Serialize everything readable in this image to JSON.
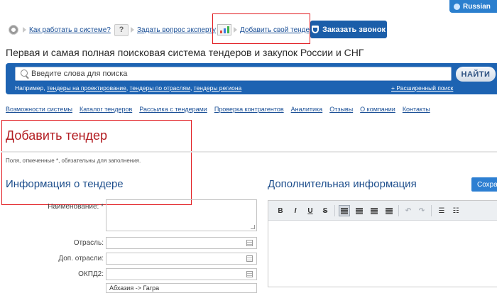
{
  "lang": {
    "label": "Russian"
  },
  "toolbar": {
    "how_it_works": "Как работать в системе?",
    "ask_expert": "Задать вопрос эксперту",
    "add_tender": "Добавить свой тендер",
    "call_button": "Заказать звонок",
    "question_mark": "?"
  },
  "tagline": "Первая и самая полная поисковая система тендеров и закупок России и СНГ",
  "search": {
    "placeholder": "Введите слова для поиска",
    "button": "НАЙТИ",
    "examples_prefix": "Например,",
    "examples": [
      "тендеры на проектирование",
      "тендеры по отраслям",
      "тендеры региона"
    ],
    "advanced": "+ Расширенный поиск"
  },
  "nav": [
    "Возможности системы",
    "Каталог тендеров",
    "Рассылка с тендерами",
    "Проверка контрагентов",
    "Аналитика",
    "Отзывы",
    "О компании",
    "Контакты"
  ],
  "main": {
    "title": "Добавить тендер",
    "required_note": "Поля, отмеченные *, обязательны для заполнения.",
    "info_section": "Информация о тендере",
    "extra_section": "Дополнительная информация",
    "save_button": "Сохра",
    "fields": {
      "name": "Наименование: *",
      "industry": "Отрасль:",
      "extra_industry": "Доп. отрасли:",
      "okpd": "ОКПД2:",
      "region_value": "Абхазия -> Гагра"
    }
  },
  "editor": {
    "bold": "B",
    "italic": "I",
    "underline": "U",
    "strike": "S"
  }
}
